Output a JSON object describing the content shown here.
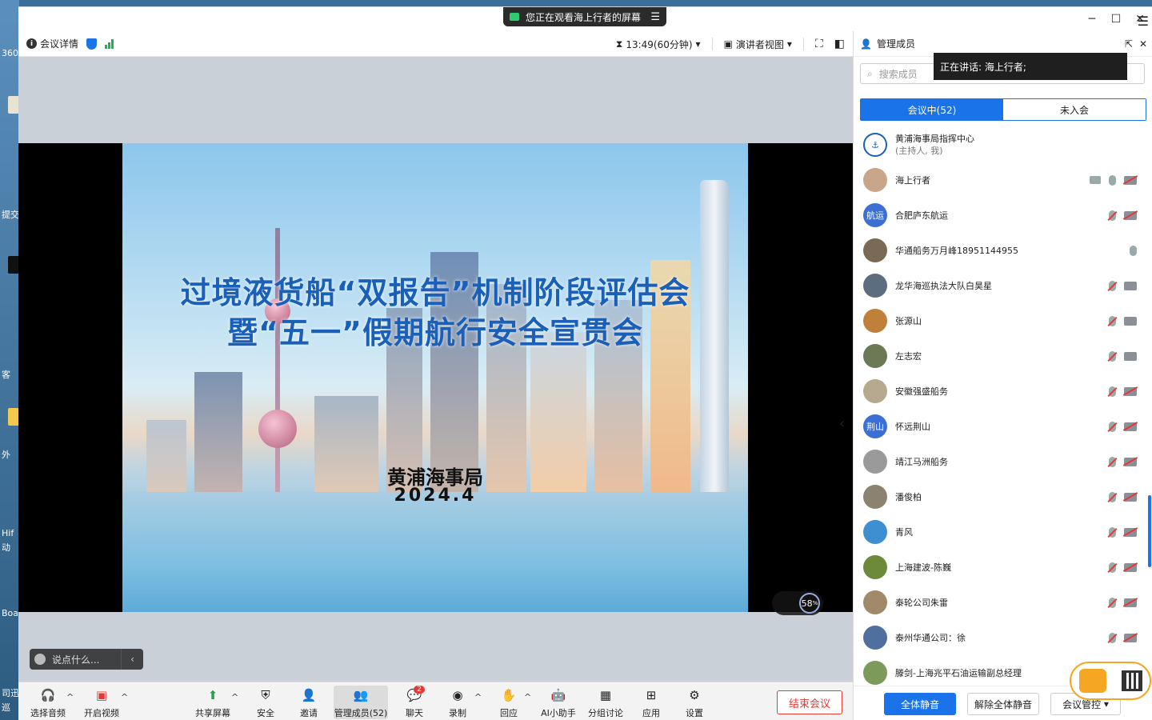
{
  "desktop": {
    "labels": [
      "360",
      "提交",
      "客",
      "外",
      "Hif",
      "动",
      "Boa",
      "司迅",
      "巡"
    ]
  },
  "titlebar": {
    "share_notice": "您正在观看海上行者的屏幕",
    "menu_icon": "menu-icon",
    "controls": [
      "─",
      "☐",
      "✕"
    ]
  },
  "topbar": {
    "meeting_details": "会议详情",
    "timer": "13:49(60分钟)",
    "view_mode": "演讲者视图"
  },
  "slide": {
    "title_line1": "过境液货船“双报告”机制阶段评估会",
    "title_line2": "暨“五一”假期航行安全宣贯会",
    "organization": "黄浦海事局",
    "date": "2024.4"
  },
  "stage": {
    "chat_placeholder": "说点什么...",
    "perf_value": "58",
    "perf_unit": "%"
  },
  "toolbar": {
    "items": [
      {
        "label": "选择音频",
        "icon": "headset-icon"
      },
      {
        "label": "开启视频",
        "icon": "camera-off-icon"
      },
      {
        "label": "共享屏幕",
        "icon": "share-screen-icon"
      },
      {
        "label": "安全",
        "icon": "shield-icon"
      },
      {
        "label": "邀请",
        "icon": "invite-icon"
      },
      {
        "label": "管理成员(52)",
        "icon": "members-icon"
      },
      {
        "label": "聊天",
        "icon": "chat-icon",
        "badge": "2"
      },
      {
        "label": "录制",
        "icon": "record-icon"
      },
      {
        "label": "回应",
        "icon": "reaction-icon"
      },
      {
        "label": "AI小助手",
        "icon": "ai-assistant-icon"
      },
      {
        "label": "分组讨论",
        "icon": "breakout-icon"
      },
      {
        "label": "应用",
        "icon": "apps-icon"
      },
      {
        "label": "设置",
        "icon": "settings-icon"
      }
    ],
    "end_meeting": "结束会议"
  },
  "panel": {
    "title": "管理成员",
    "search_placeholder": "搜索成员",
    "speaking_tooltip": "正在讲话:  海上行者;",
    "tab_in_meeting": "会议中(52)",
    "tab_not_joined": "未入会",
    "members": [
      {
        "name": "黄浦海事局指挥中心",
        "sub": "(主持人, 我)",
        "avatar": "logo",
        "mic": "",
        "cam": ""
      },
      {
        "name": "海上行者",
        "sub": "",
        "avatar": "photo",
        "share": true,
        "mic": "on",
        "cam": "off"
      },
      {
        "name": "合肥庐东航运",
        "sub": "",
        "avatar_text": "航运",
        "mic": "muted",
        "cam": "off"
      },
      {
        "name": "华通船务万月峰18951144955",
        "sub": "",
        "avatar": "photo",
        "mic": "on",
        "cam": ""
      },
      {
        "name": "龙华海巡执法大队白昊星",
        "sub": "",
        "avatar": "photo",
        "mic": "muted",
        "cam": "on"
      },
      {
        "name": "张源山",
        "sub": "",
        "avatar": "photo",
        "mic": "muted",
        "cam": "on"
      },
      {
        "name": "左志宏",
        "sub": "",
        "avatar": "photo",
        "mic": "muted",
        "cam": "on"
      },
      {
        "name": "安徽强盛船务",
        "sub": "",
        "avatar": "photo",
        "mic": "muted",
        "cam": "off"
      },
      {
        "name": "怀远荆山",
        "sub": "",
        "avatar_text": "荆山",
        "mic": "muted",
        "cam": "off"
      },
      {
        "name": "靖江马洲船务",
        "sub": "",
        "avatar": "photo",
        "mic": "muted",
        "cam": "off"
      },
      {
        "name": "潘俊柏",
        "sub": "",
        "avatar": "photo",
        "mic": "muted",
        "cam": "off"
      },
      {
        "name": "青风",
        "sub": "",
        "avatar": "photo",
        "mic": "muted",
        "cam": "off"
      },
      {
        "name": "上海建波-陈巍",
        "sub": "",
        "avatar": "photo",
        "mic": "muted",
        "cam": "off"
      },
      {
        "name": "泰轮公司朱雷",
        "sub": "",
        "avatar": "photo",
        "mic": "muted",
        "cam": "off"
      },
      {
        "name": "泰州华通公司：徐",
        "sub": "",
        "avatar": "photo",
        "mic": "muted",
        "cam": "off"
      },
      {
        "name": "滕剑-上海兆平石油运输副总经理",
        "sub": "",
        "avatar": "photo",
        "mic": "",
        "cam": ""
      }
    ],
    "mute_all": "全体静音",
    "unmute_all": "解除全体静音",
    "meeting_control": "会议管控"
  },
  "colors": {
    "accent": "#1a73e8",
    "danger": "#e53935",
    "slide_title": "#1a5fb8"
  }
}
